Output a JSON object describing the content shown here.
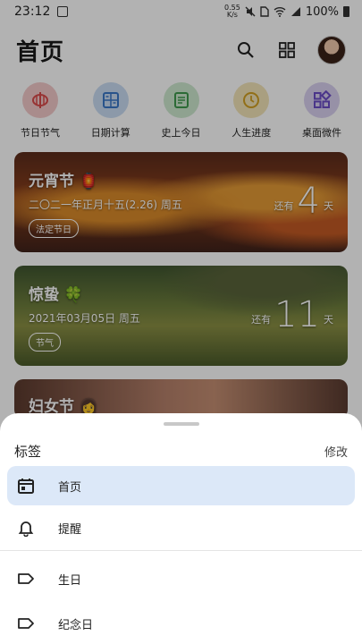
{
  "status_bar": {
    "time": "23:12",
    "net_speed_top": "0.55",
    "net_speed_unit": "K/s",
    "battery": "100%"
  },
  "header": {
    "title": "首页"
  },
  "shortcuts": [
    {
      "label": "节日节气",
      "color": "#f3c9c9",
      "icon_color": "#d94a4a",
      "icon": "lantern-icon"
    },
    {
      "label": "日期计算",
      "color": "#c9dcf3",
      "icon_color": "#3a78c7",
      "icon": "calculator-icon"
    },
    {
      "label": "史上今日",
      "color": "#cde8cf",
      "icon_color": "#3f9a4e",
      "icon": "history-icon"
    },
    {
      "label": "人生进度",
      "color": "#f3e4b8",
      "icon_color": "#d1a022",
      "icon": "clock-icon"
    },
    {
      "label": "桌面微件",
      "color": "#d9d0f0",
      "icon_color": "#6a4cc6",
      "icon": "widgets-icon"
    }
  ],
  "cards": [
    {
      "title": "元宵节 🏮",
      "date": "二〇二一年正月十五(2.26) 周五",
      "tag": "法定节日",
      "prefix": "还有",
      "count": "4",
      "unit": "天"
    },
    {
      "title": "惊蛰 🍀",
      "date": "2021年03月05日 周五",
      "tag": "节气",
      "prefix": "还有",
      "count": "11",
      "unit": "天"
    },
    {
      "title": "妇女节 👩"
    }
  ],
  "sheet": {
    "title": "标签",
    "edit": "修改",
    "items": [
      {
        "label": "首页",
        "icon": "calendar-icon"
      },
      {
        "label": "提醒",
        "icon": "bell-icon"
      },
      {
        "label": "生日",
        "icon": "label-icon"
      },
      {
        "label": "纪念日",
        "icon": "label-icon"
      }
    ]
  }
}
